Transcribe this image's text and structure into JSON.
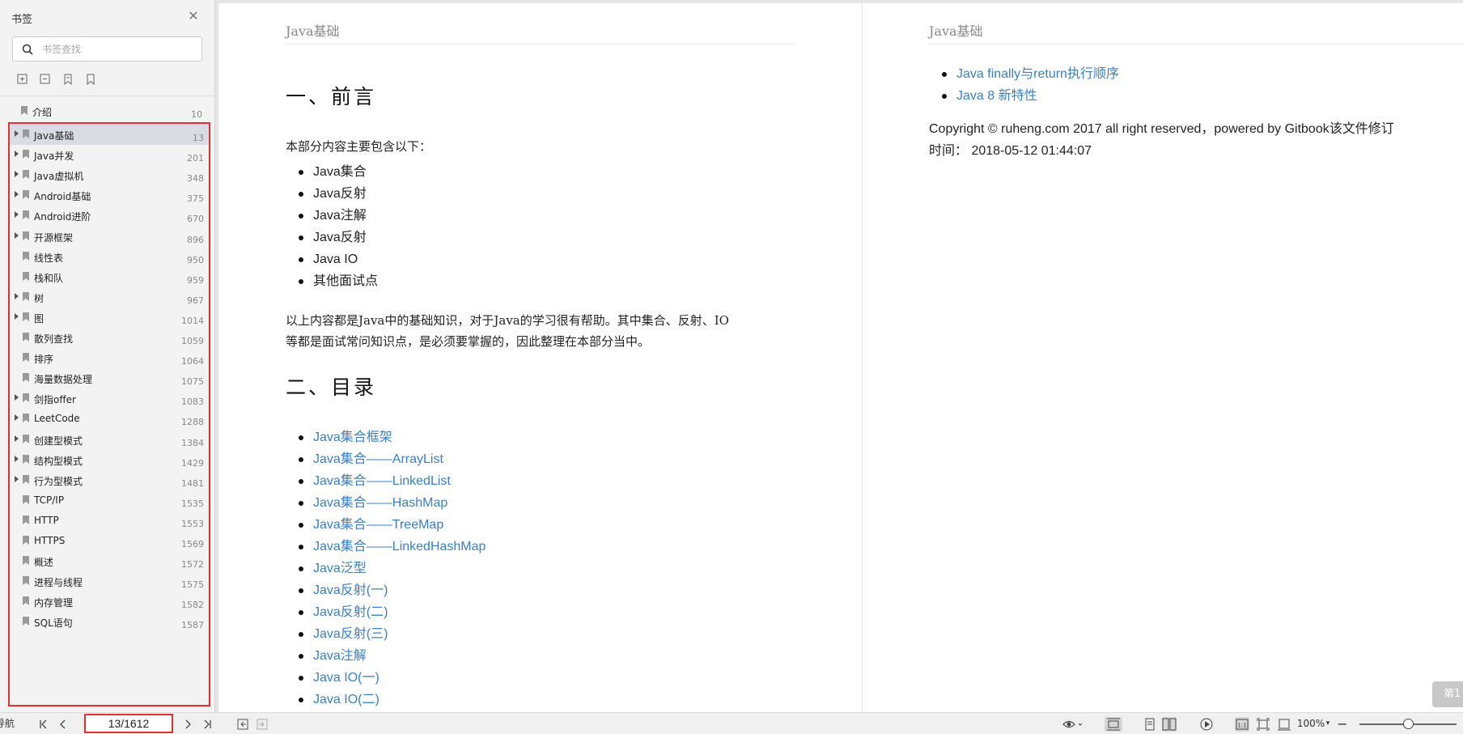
{
  "sidebar": {
    "title": "书签",
    "search_placeholder": "书签查找",
    "icons": [
      "expand-all-icon",
      "collapse-all-icon",
      "add-bookmark-icon",
      "bookmark-icon"
    ],
    "items": [
      {
        "label": "介绍",
        "page": "10",
        "expandable": false,
        "active": false
      },
      {
        "label": "Java基础",
        "page": "13",
        "expandable": true,
        "active": true
      },
      {
        "label": "Java并发",
        "page": "201",
        "expandable": true,
        "active": false
      },
      {
        "label": "Java虚拟机",
        "page": "348",
        "expandable": true,
        "active": false
      },
      {
        "label": "Android基础",
        "page": "375",
        "expandable": true,
        "active": false
      },
      {
        "label": "Android进阶",
        "page": "670",
        "expandable": true,
        "active": false
      },
      {
        "label": "开源框架",
        "page": "896",
        "expandable": true,
        "active": false
      },
      {
        "label": "线性表",
        "page": "950",
        "expandable": false,
        "active": false
      },
      {
        "label": "栈和队",
        "page": "959",
        "expandable": false,
        "active": false
      },
      {
        "label": "树",
        "page": "967",
        "expandable": true,
        "active": false
      },
      {
        "label": "图",
        "page": "1014",
        "expandable": true,
        "active": false
      },
      {
        "label": "散列查找",
        "page": "1059",
        "expandable": false,
        "active": false
      },
      {
        "label": "排序",
        "page": "1064",
        "expandable": false,
        "active": false
      },
      {
        "label": "海量数据处理",
        "page": "1075",
        "expandable": false,
        "active": false
      },
      {
        "label": "剑指offer",
        "page": "1083",
        "expandable": true,
        "active": false
      },
      {
        "label": "LeetCode",
        "page": "1288",
        "expandable": true,
        "active": false
      },
      {
        "label": "创建型模式",
        "page": "1384",
        "expandable": true,
        "active": false
      },
      {
        "label": "结构型模式",
        "page": "1429",
        "expandable": true,
        "active": false
      },
      {
        "label": "行为型模式",
        "page": "1481",
        "expandable": true,
        "active": false
      },
      {
        "label": "TCP/IP",
        "page": "1535",
        "expandable": false,
        "active": false
      },
      {
        "label": "HTTP",
        "page": "1553",
        "expandable": false,
        "active": false
      },
      {
        "label": "HTTPS",
        "page": "1569",
        "expandable": false,
        "active": false
      },
      {
        "label": "概述",
        "page": "1572",
        "expandable": false,
        "active": false
      },
      {
        "label": "进程与线程",
        "page": "1575",
        "expandable": false,
        "active": false
      },
      {
        "label": "内存管理",
        "page": "1582",
        "expandable": false,
        "active": false
      },
      {
        "label": "SQL语句",
        "page": "1587",
        "expandable": false,
        "active": false
      }
    ]
  },
  "left_page": {
    "running_head": "Java基础",
    "h1_intro": "一、前言",
    "intro_text": "本部分内容主要包含以下：",
    "topics": [
      "Java集合",
      "Java反射",
      "Java注解",
      "Java反射",
      "Java IO",
      "其他面试点"
    ],
    "summary_line1": "以上内容都是Java中的基础知识，对于Java的学习很有帮助。其中集合、反射、IO",
    "summary_line2": "等都是面试常问知识点，是必须要掌握的，因此整理在本部分当中。",
    "h1_toc": "二、目录",
    "toc_links": [
      "Java集合框架",
      "Java集合——ArrayList",
      "Java集合——LinkedList",
      "Java集合——HashMap",
      "Java集合——TreeMap",
      "Java集合——LinkedHashMap",
      "Java泛型",
      "Java反射(一)",
      "Java反射(二)",
      "Java反射(三)",
      "Java注解",
      "Java IO(一)",
      "Java IO(二)"
    ]
  },
  "right_page": {
    "running_head": "Java基础",
    "links": [
      "Java finally与return执行顺序",
      "Java 8 新特性"
    ],
    "copyright_line1": "Copyright © ruheng.com 2017 all right reserved，powered by Gitbook该文件修订",
    "copyright_line2": "时间： 2018-05-12 01:44:07",
    "page_badge": "第1"
  },
  "statusbar": {
    "nav_label": "导航",
    "page_indicator": "13/1612",
    "zoom": "100%",
    "zoom_level": 0.5
  }
}
